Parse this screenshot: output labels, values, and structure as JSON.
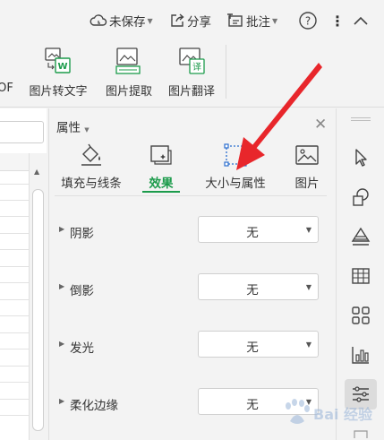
{
  "header": {
    "unsaved": "未保存",
    "share": "分享",
    "review": "批注",
    "help": "?",
    "more": "⋮",
    "collapse": "∧"
  },
  "ribbon": {
    "partial_label": "OF",
    "buttons": [
      {
        "label": "图片转文字",
        "icon": "image-to-text-icon"
      },
      {
        "label": "图片提取",
        "icon": "image-extract-icon"
      },
      {
        "label": "图片翻译",
        "icon": "image-translate-icon"
      }
    ]
  },
  "panel": {
    "title": "属性",
    "tabs": [
      {
        "label": "填充与线条",
        "icon": "fill-line-icon",
        "active": false
      },
      {
        "label": "效果",
        "icon": "effects-icon",
        "active": true
      },
      {
        "label": "大小与属性",
        "icon": "size-props-icon",
        "active": false
      },
      {
        "label": "图片",
        "icon": "picture-icon",
        "active": false
      }
    ],
    "rows": [
      {
        "label": "阴影",
        "value": "无"
      },
      {
        "label": "倒影",
        "value": "无"
      },
      {
        "label": "发光",
        "value": "无"
      },
      {
        "label": "柔化边缘",
        "value": "无"
      }
    ]
  },
  "rightbar": {
    "tools": [
      "select-cursor-icon",
      "shapes-icon",
      "fill-style-icon",
      "table-icon",
      "grid-apps-icon",
      "chart-icon",
      "properties-sliders-icon"
    ]
  },
  "colors": {
    "accent_green": "#1c9b4b",
    "arrow_red": "#e8262b",
    "watermark_blue": "#2a6ecf"
  },
  "watermark": {
    "text": "Bai 经验"
  }
}
